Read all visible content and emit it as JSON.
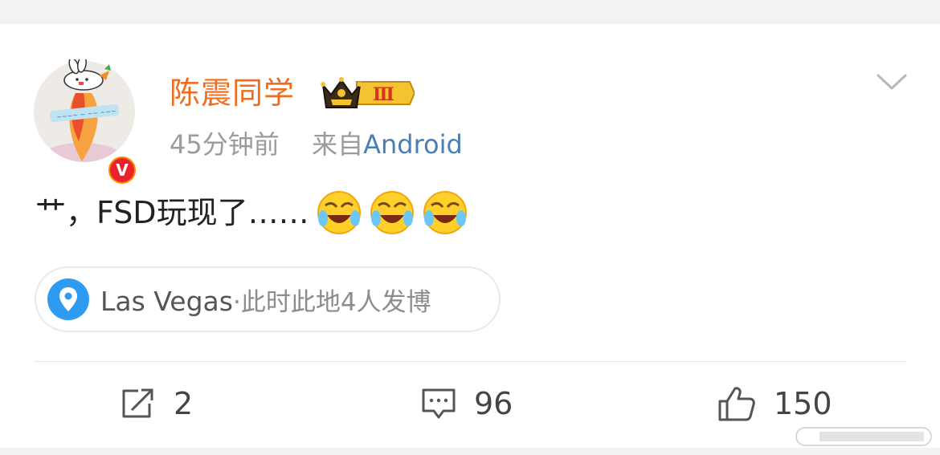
{
  "post": {
    "username": "陈震同学",
    "vip_level": "Ⅲ",
    "verified_mark": "V",
    "time": "45分钟前",
    "source_prefix": "来自",
    "source": "Android",
    "content": "艹，FSD玩现了……",
    "emojis": [
      "laugh-cry-emoji",
      "laugh-cry-emoji",
      "laugh-cry-emoji"
    ]
  },
  "location": {
    "place": "Las Vegas",
    "detail": "·此时此地4人发博"
  },
  "actions": {
    "repost_count": "2",
    "comment_count": "96",
    "like_count": "150"
  },
  "colors": {
    "username": "#f06d1d",
    "source_link": "#4a7fb4",
    "location_icon": "#2f9bf0",
    "verified_badge": "#e8232b"
  }
}
